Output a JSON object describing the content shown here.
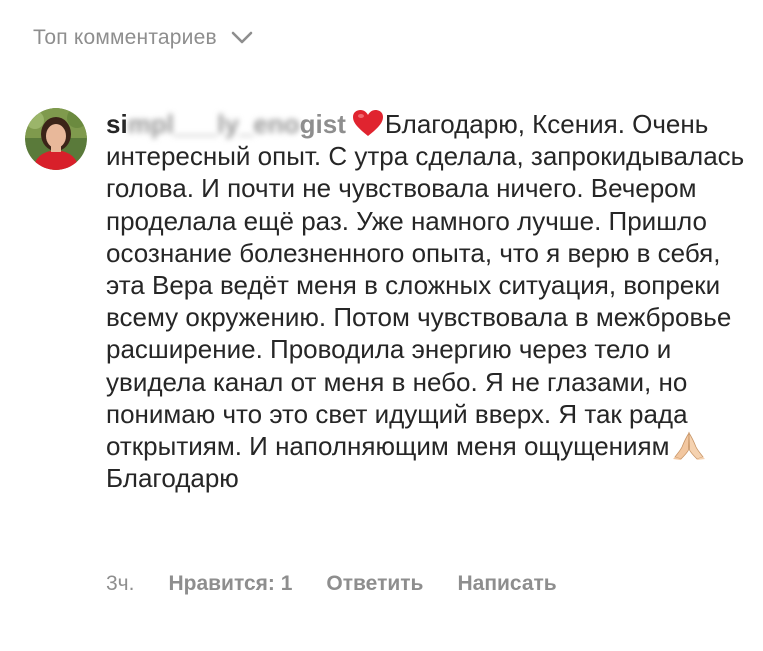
{
  "header": {
    "sort_label": "Топ комментариев"
  },
  "comment": {
    "username_visible_start": "si",
    "username_blurred": "mpl___ly_eno",
    "username_visible_end": "gist",
    "text_first": "Благодарю, Ксения. Очень интересный опыт. С утра сделала, запрокидывалась голова. И почти не чувствовала ничего. Вечером проделала ещё раз. Уже намного лучше. Пришло осознание болезненного опыта, что я верю в себя, эта Вера ведёт меня в сложных ситуация, вопреки всему окружению. Потом чувствовала в межбровье расширение. Проводила энергию через тело и увидела канал от меня в небо. Я не глазами, но понимаю что это свет  идущий вверх. Я так рада открытиям. И наполняющим меня ощущениям",
    "text_last": "Благодарю",
    "emoji_1": "heart-emoji",
    "emoji_2": "praying-hands-emoji"
  },
  "meta": {
    "time": "3ч.",
    "likes": "Нравится: 1",
    "reply": "Ответить",
    "write": "Написать"
  },
  "colors": {
    "text": "#262626",
    "secondary": "#8e8e8e",
    "heart": "#e0242f"
  }
}
